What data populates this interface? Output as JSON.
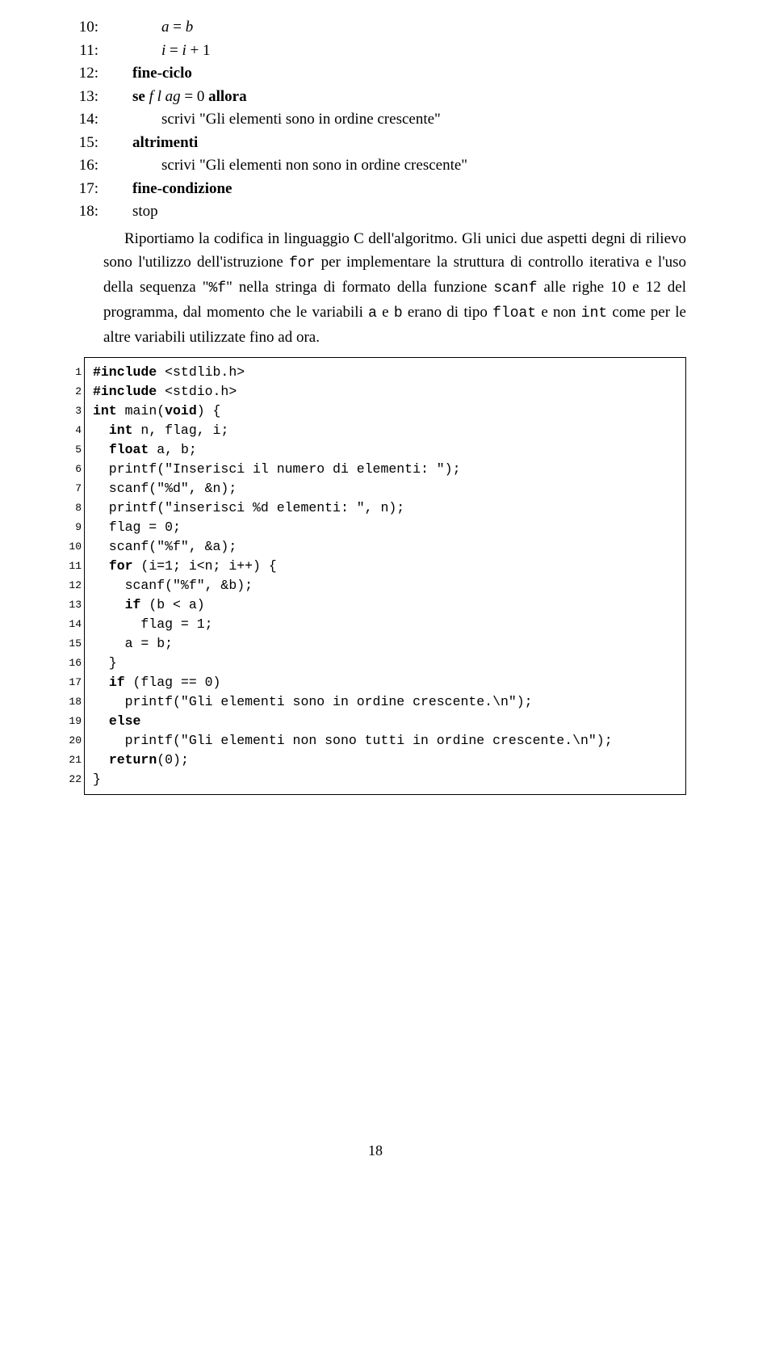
{
  "algo": [
    {
      "n": "10:",
      "indent": "indent2",
      "parts": [
        "a",
        " = ",
        "b"
      ],
      "styles": [
        "mi",
        "mn",
        "mi"
      ]
    },
    {
      "n": "11:",
      "indent": "indent2",
      "parts": [
        "i",
        " = ",
        "i",
        " + 1"
      ],
      "styles": [
        "mi",
        "mn",
        "mi",
        "mn"
      ]
    },
    {
      "n": "12:",
      "indent": "indent1",
      "text": "fine-ciclo",
      "kw": true
    },
    {
      "n": "13:",
      "indent": "indent1",
      "segs": [
        {
          "t": "se ",
          "kw": true
        },
        {
          "t": "f l ag",
          "mi": true
        },
        {
          "t": " = 0 ",
          "mn": true
        },
        {
          "t": "allora",
          "kw": true
        }
      ]
    },
    {
      "n": "14:",
      "indent": "indent2",
      "segs": [
        {
          "t": "scrivi \"Gli elementi sono in ordine crescente\""
        }
      ]
    },
    {
      "n": "15:",
      "indent": "indent1",
      "text": "altrimenti",
      "kw": true
    },
    {
      "n": "16:",
      "indent": "indent2",
      "segs": [
        {
          "t": "scrivi \"Gli elementi non sono in ordine crescente\""
        }
      ]
    },
    {
      "n": "17:",
      "indent": "indent1",
      "text": "fine-condizione",
      "kw": true
    },
    {
      "n": "18:",
      "indent": "indent1",
      "segs": [
        {
          "t": "stop"
        }
      ]
    }
  ],
  "para_pre": "Riportiamo la codifica in linguaggio C dell'algoritmo. Gli unici due aspetti degni di rilievo sono l'utilizzo dell'istruzione ",
  "para_tt1": "for",
  "para_mid1": " per implementare la struttura di controllo iterativa e l'uso della sequenza \"",
  "para_tt2": "%f",
  "para_mid2": "\" nella stringa di formato della funzione ",
  "para_tt3": "scanf",
  "para_mid3": " alle righe 10 e 12 del programma, dal momento che le variabili ",
  "para_tt4": "a",
  "para_mid4": " e ",
  "para_tt5": "b",
  "para_mid5": " erano di tipo ",
  "para_tt6": "float",
  "para_mid6": " e non ",
  "para_tt7": "int",
  "para_end": " come per le altre variabili utilizzate fino ad ora.",
  "code": [
    [
      {
        "t": "#include ",
        "k": 1
      },
      {
        "t": "<stdlib.h>"
      }
    ],
    [
      {
        "t": "#include ",
        "k": 1
      },
      {
        "t": "<stdio.h>"
      }
    ],
    [
      {
        "t": "int ",
        "k": 1
      },
      {
        "t": "main(",
        "k": 0
      },
      {
        "t": "void",
        "k": 1
      },
      {
        "t": ") {"
      }
    ],
    [
      {
        "t": "  "
      },
      {
        "t": "int ",
        "k": 1
      },
      {
        "t": "n, flag, i;"
      }
    ],
    [
      {
        "t": "  "
      },
      {
        "t": "float ",
        "k": 1
      },
      {
        "t": "a, b;"
      }
    ],
    [
      {
        "t": "  printf(\"Inserisci il numero di elementi: \");"
      }
    ],
    [
      {
        "t": "  scanf(\"%d\", &n);"
      }
    ],
    [
      {
        "t": "  printf(\"inserisci %d elementi: \", n);"
      }
    ],
    [
      {
        "t": "  flag = 0;"
      }
    ],
    [
      {
        "t": "  scanf(\"%f\", &a);"
      }
    ],
    [
      {
        "t": "  "
      },
      {
        "t": "for ",
        "k": 1
      },
      {
        "t": "(i=1; i<n; i++) {"
      }
    ],
    [
      {
        "t": "    scanf(\"%f\", &b);"
      }
    ],
    [
      {
        "t": "    "
      },
      {
        "t": "if ",
        "k": 1
      },
      {
        "t": "(b < a)"
      }
    ],
    [
      {
        "t": "      flag = 1;"
      }
    ],
    [
      {
        "t": "    a = b;"
      }
    ],
    [
      {
        "t": "  }"
      }
    ],
    [
      {
        "t": "  "
      },
      {
        "t": "if ",
        "k": 1
      },
      {
        "t": "(flag == 0)"
      }
    ],
    [
      {
        "t": "    printf(\"Gli elementi sono in ordine crescente.\\n\");"
      }
    ],
    [
      {
        "t": "  "
      },
      {
        "t": "else",
        "k": 1
      }
    ],
    [
      {
        "t": "    printf(\"Gli elementi non sono tutti in ordine crescente.\\n\");"
      }
    ],
    [
      {
        "t": "  "
      },
      {
        "t": "return",
        "k": 1
      },
      {
        "t": "(0);"
      }
    ],
    [
      {
        "t": "}"
      }
    ]
  ],
  "pageno": "18"
}
